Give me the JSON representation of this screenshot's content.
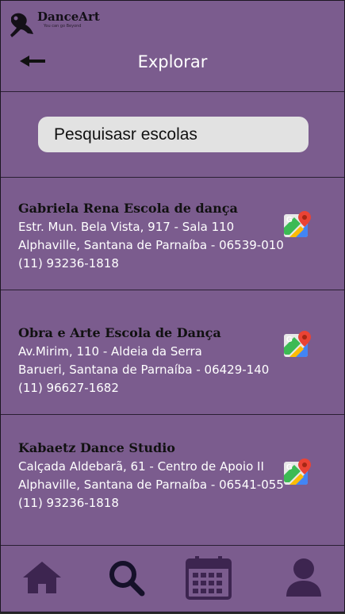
{
  "brand": {
    "name": "DanceArt",
    "tagline": "You can go Beyond"
  },
  "header": {
    "title": "Explorar",
    "back_icon": "arrow-left-icon"
  },
  "search": {
    "placeholder": "Pesquisasr escolas"
  },
  "schools": [
    {
      "name": "Gabriela Rena Escola de dança",
      "address1": "Estr. Mun. Bela Vista, 917 - Sala 110",
      "address2": "Alphaville, Santana de Parnaíba - 06539-010",
      "phone": "(11) 93236-1818"
    },
    {
      "name": "Obra e Arte Escola de Dança",
      "address1": "Av.Mirim, 110 - Aldeia da Serra",
      "address2": "Barueri, Santana de Parnaíba - 06429-140",
      "phone": "(11) 96627-1682"
    },
    {
      "name": "Kabaetz Dance Studio",
      "address1": "Calçada Aldebarã, 61 - Centro de Apoio II",
      "address2": "Alphaville, Santana de Parnaíba - 06541-055",
      "phone": "(11) 93236-1818"
    }
  ],
  "tabs": [
    "home-icon",
    "search-icon",
    "calendar-icon",
    "user-icon"
  ],
  "colors": {
    "background": "#7b5c8e",
    "icon": "#3d2550",
    "active_icon": "#16112a",
    "search_bg": "#e2e2e2"
  }
}
